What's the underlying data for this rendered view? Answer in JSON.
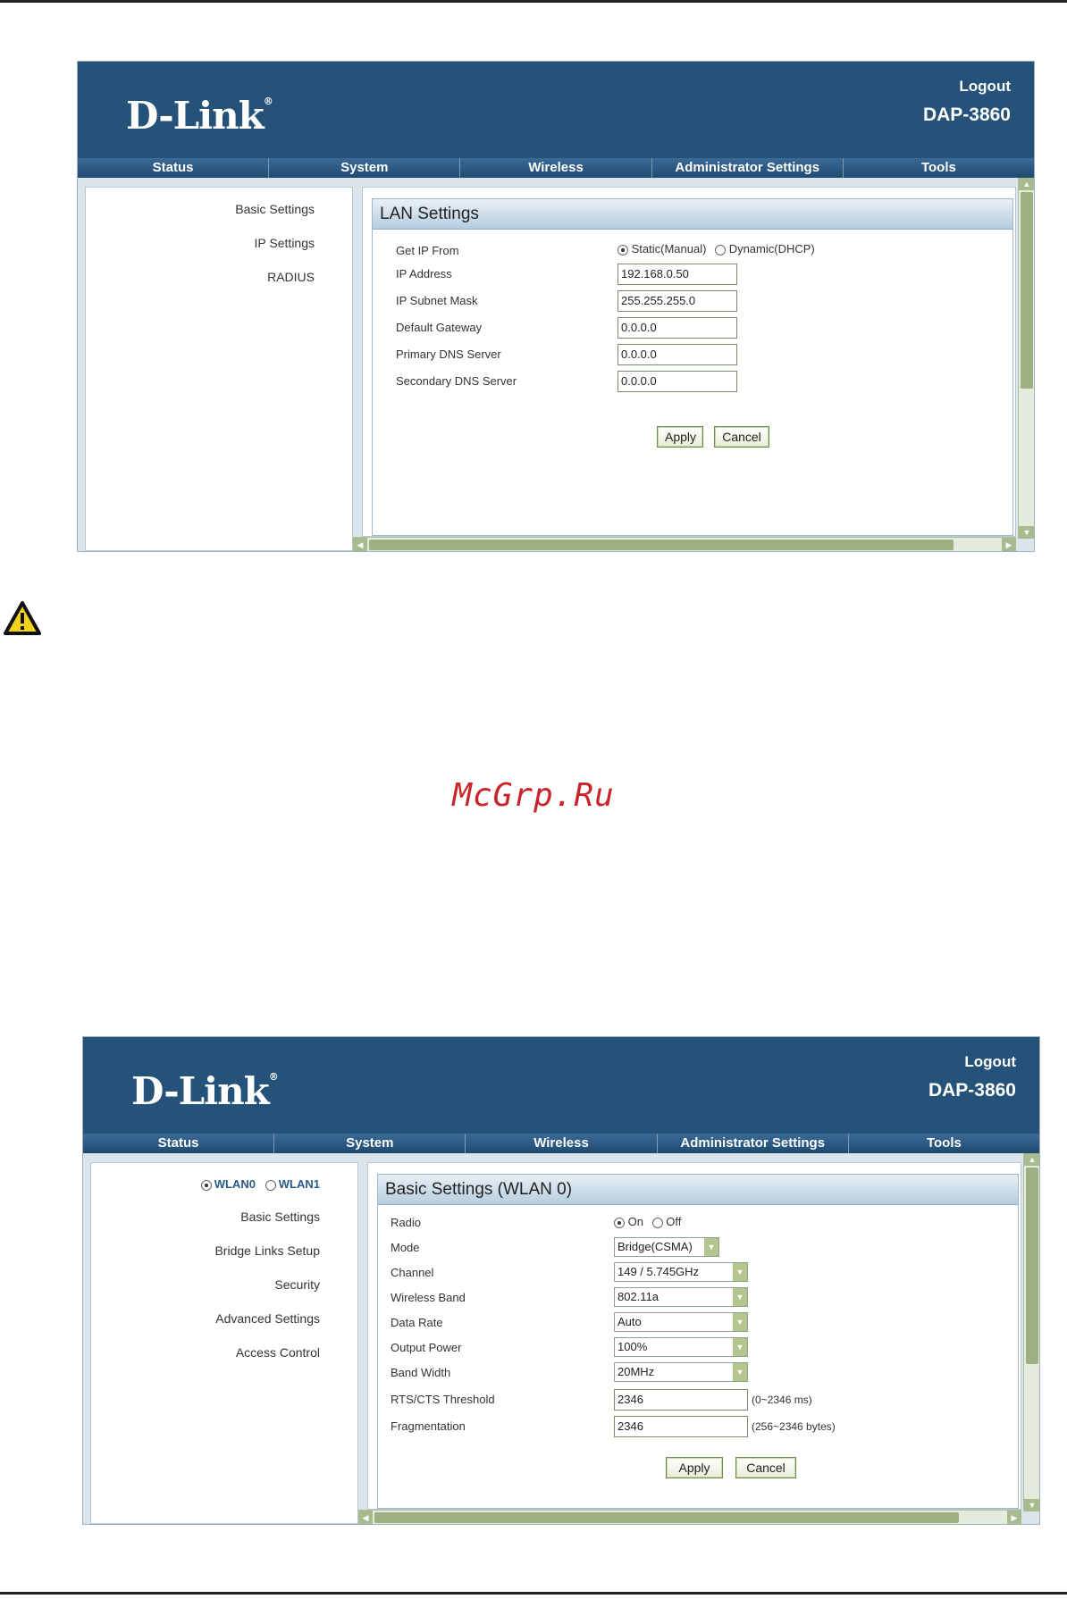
{
  "shot1": {
    "brand": "D-Link",
    "logout": "Logout",
    "model": "DAP-3860",
    "nav": [
      "Status",
      "System",
      "Wireless",
      "Administrator Settings",
      "Tools"
    ],
    "sidebar": [
      "Basic Settings",
      "IP Settings",
      "RADIUS"
    ],
    "panel_title": "LAN Settings",
    "get_ip_label": "Get IP From",
    "ip_options": [
      "Static(Manual)",
      "Dynamic(DHCP)"
    ],
    "ip_selected": "Static(Manual)",
    "fields": [
      {
        "label": "IP Address",
        "value": "192.168.0.50"
      },
      {
        "label": "IP Subnet Mask",
        "value": "255.255.255.0"
      },
      {
        "label": "Default Gateway",
        "value": "0.0.0.0"
      },
      {
        "label": "Primary DNS Server",
        "value": "0.0.0.0"
      },
      {
        "label": "Secondary DNS Server",
        "value": "0.0.0.0"
      }
    ],
    "apply": "Apply",
    "cancel": "Cancel"
  },
  "shot2": {
    "brand": "D-Link",
    "logout": "Logout",
    "model": "DAP-3860",
    "nav": [
      "Status",
      "System",
      "Wireless",
      "Administrator Settings",
      "Tools"
    ],
    "wlan_options": [
      "WLAN0",
      "WLAN1"
    ],
    "wlan_selected": "WLAN0",
    "sidebar": [
      "Basic Settings",
      "Bridge Links Setup",
      "Security",
      "Advanced Settings",
      "Access Control"
    ],
    "panel_title": "Basic Settings (WLAN 0)",
    "radio_label": "Radio",
    "radio_options": [
      "On",
      "Off"
    ],
    "radio_selected": "On",
    "selects": [
      {
        "label": "Mode",
        "value": "Bridge(CSMA)"
      },
      {
        "label": "Channel",
        "value": "149 / 5.745GHz"
      },
      {
        "label": "Wireless Band",
        "value": "802.11a"
      },
      {
        "label": "Data Rate",
        "value": "Auto"
      },
      {
        "label": "Output Power",
        "value": "100%"
      },
      {
        "label": "Band Width",
        "value": "20MHz"
      }
    ],
    "inputs": [
      {
        "label": "RTS/CTS Threshold",
        "value": "2346",
        "unit": "(0~2346 ms)"
      },
      {
        "label": "Fragmentation",
        "value": "2346",
        "unit": "(256~2346 bytes)"
      }
    ],
    "apply": "Apply",
    "cancel": "Cancel"
  },
  "watermark": "McGrp.Ru",
  "colors": {
    "header": "#245279",
    "button_border": "#6d8a50",
    "watermark": "#c8252b"
  }
}
